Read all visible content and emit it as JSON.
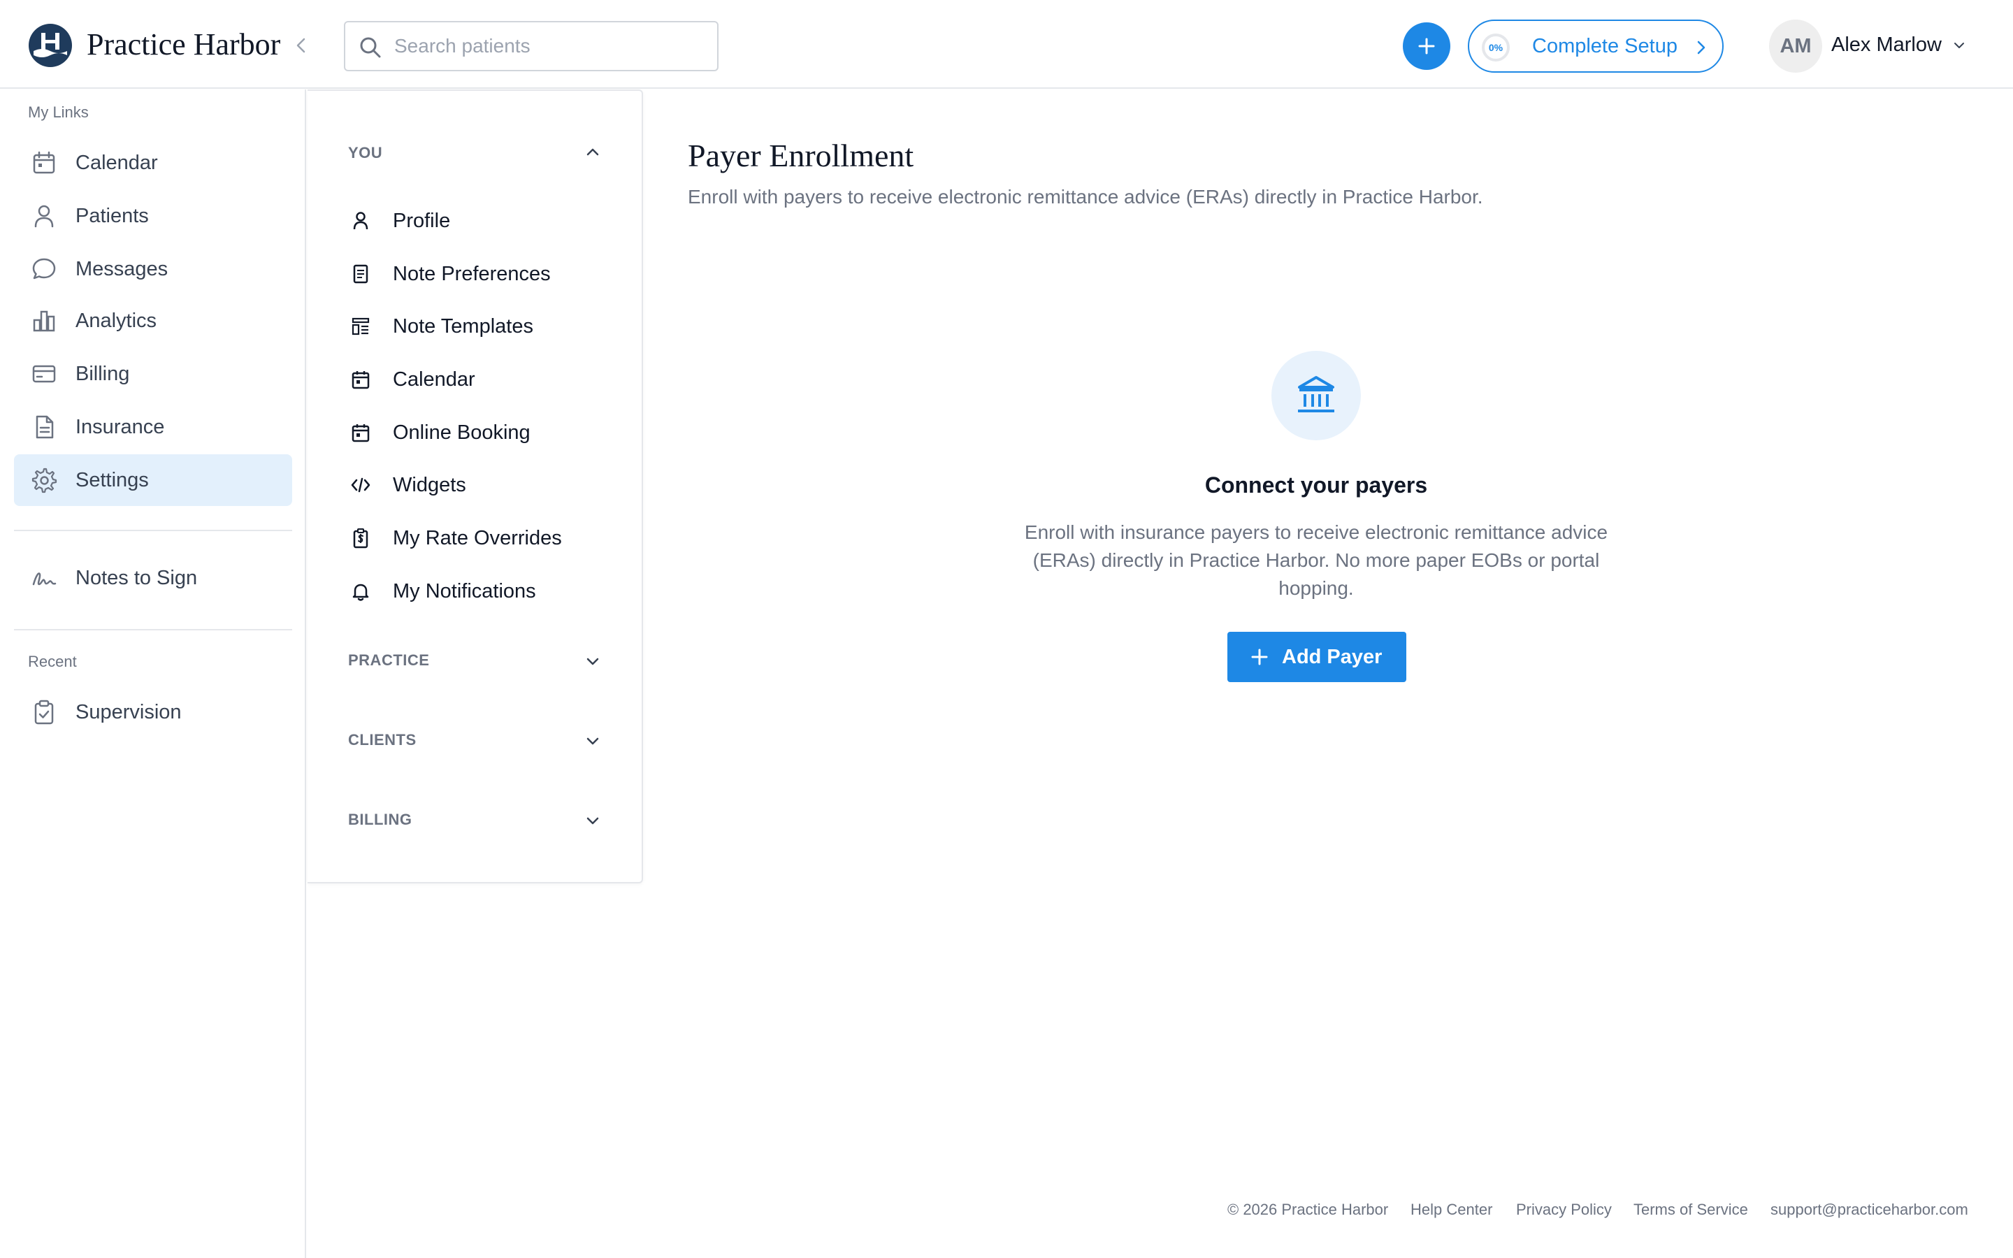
{
  "header": {
    "brand_name": "Practice Harbor",
    "search_placeholder": "Search patients",
    "search_value": "",
    "setup": {
      "progress_text": "0%",
      "progress_fraction": 0,
      "label": "Complete Setup"
    },
    "user": {
      "initials": "AM",
      "name": "Alex Marlow"
    }
  },
  "sidebar": {
    "my_links_label": "My Links",
    "items": [
      {
        "label": "Calendar",
        "icon": "calendar-icon"
      },
      {
        "label": "Patients",
        "icon": "user-icon"
      },
      {
        "label": "Messages",
        "icon": "chat-bubble-icon"
      },
      {
        "label": "Analytics",
        "icon": "bar-chart-icon"
      },
      {
        "label": "Billing",
        "icon": "credit-card-icon"
      },
      {
        "label": "Insurance",
        "icon": "document-icon"
      },
      {
        "label": "Settings",
        "icon": "gear-icon",
        "active": true
      }
    ],
    "notes_to_sign": {
      "label": "Notes to Sign",
      "icon": "signature-icon"
    },
    "recent_label": "Recent",
    "recent_items": [
      {
        "label": "Supervision",
        "icon": "clipboard-check-icon"
      }
    ]
  },
  "settings_menu": {
    "you": {
      "label": "YOU",
      "expanded": true,
      "items": [
        {
          "label": "Profile",
          "icon": "user-icon"
        },
        {
          "label": "Note Preferences",
          "icon": "note-icon"
        },
        {
          "label": "Note Templates",
          "icon": "template-icon"
        },
        {
          "label": "Calendar",
          "icon": "calendar-icon"
        },
        {
          "label": "Online Booking",
          "icon": "calendar-icon"
        },
        {
          "label": "Widgets",
          "icon": "code-icon"
        },
        {
          "label": "My Rate Overrides",
          "icon": "dollar-clipboard-icon"
        },
        {
          "label": "My Notifications",
          "icon": "bell-icon"
        }
      ]
    },
    "practice": {
      "label": "PRACTICE",
      "expanded": false
    },
    "clients": {
      "label": "CLIENTS",
      "expanded": false
    },
    "billing": {
      "label": "BILLING",
      "expanded": false
    }
  },
  "main": {
    "title": "Payer Enrollment",
    "subtitle": "Enroll with payers to receive electronic remittance advice (ERAs) directly in Practice Harbor.",
    "empty_state": {
      "icon": "bank-icon",
      "title": "Connect your payers",
      "text": "Enroll with insurance payers to receive electronic remittance advice (ERAs) directly in Practice Harbor. No more paper EOBs or portal hopping.",
      "button_label": "Add Payer"
    }
  },
  "footer": {
    "copyright": "© 2026 Practice Harbor",
    "links": [
      "Help Center",
      "Privacy Policy",
      "Terms of Service"
    ],
    "email": "support@practiceharbor.com"
  },
  "colors": {
    "accent": "#1e88e5",
    "active_bg": "#e3f0fc",
    "brand_navy": "#1f3b5c",
    "muted_text": "#6b7280"
  }
}
